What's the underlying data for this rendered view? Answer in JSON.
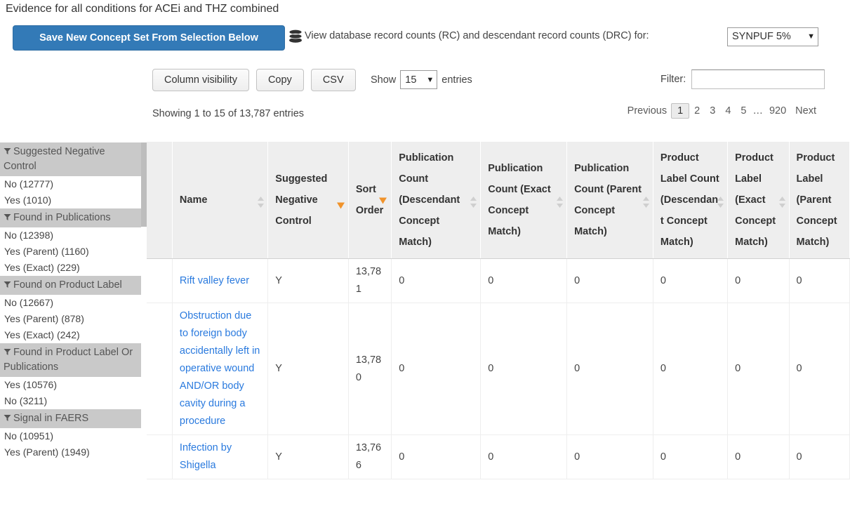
{
  "page_title": "Evidence for all conditions for ACEi and THZ combined",
  "toolbar": {
    "save_button_label": "Save New Concept Set From Selection Below",
    "db_icon": "database-icon",
    "record_counts_label": "View database record counts (RC) and descendant record counts (DRC) for:",
    "db_selected": "SYNPUF 5%",
    "caret": "▼"
  },
  "controls": {
    "column_visibility_label": "Column visibility",
    "copy_label": "Copy",
    "csv_label": "CSV",
    "show_label": "Show",
    "page_length_value": "15",
    "entries_label": "entries",
    "filter_label": "Filter:",
    "filter_value": "",
    "filter_placeholder": "",
    "info_text": "Showing 1 to 15 of 13,787 entries"
  },
  "pagination": {
    "previous": "Previous",
    "pages": [
      "1",
      "2",
      "3",
      "4",
      "5"
    ],
    "ellipsis": "…",
    "last_page": "920",
    "next": "Next",
    "current": "1"
  },
  "facets": [
    {
      "title": "Suggested Negative Control",
      "icon": "funnel-icon",
      "items": [
        "No (12777)",
        "Yes (1010)"
      ]
    },
    {
      "title": "Found in Publications",
      "icon": "funnel-icon",
      "items": [
        "No (12398)",
        "Yes (Parent) (1160)",
        "Yes (Exact) (229)"
      ]
    },
    {
      "title": "Found on Product Label",
      "icon": "funnel-icon",
      "items": [
        "No (12667)",
        "Yes (Parent) (878)",
        "Yes (Exact) (242)"
      ]
    },
    {
      "title": "Found in Product Label Or Publications",
      "icon": "funnel-icon",
      "items": [
        "Yes (10576)",
        "No (3211)"
      ]
    },
    {
      "title": "Signal in FAERS",
      "icon": "funnel-icon",
      "items": [
        "No (10951)",
        "Yes (Parent) (1949)"
      ]
    }
  ],
  "table": {
    "columns": [
      {
        "label": "",
        "sort": "none",
        "key": "check"
      },
      {
        "label": "Name",
        "sort": "both",
        "key": "name"
      },
      {
        "label": "Suggested Negative Control",
        "sort": "desc",
        "key": "snc"
      },
      {
        "label": "Sort Order",
        "sort": "desc",
        "key": "sortorder"
      },
      {
        "label": "Publication Count (Descendant Concept Match)",
        "sort": "both",
        "key": "pub_desc"
      },
      {
        "label": "Publication Count (Exact Concept Match)",
        "sort": "both",
        "key": "pub_exact"
      },
      {
        "label": "Publication Count (Parent Concept Match)",
        "sort": "both",
        "key": "pub_parent"
      },
      {
        "label": "Product Label Count (Descendant Concept Match)",
        "sort": "both",
        "key": "pl_desc"
      },
      {
        "label": "Product Label (Exact Concept Match)",
        "sort": "both",
        "key": "pl_exact"
      },
      {
        "label": "Product Label (Parent Concept Match)",
        "sort": "both",
        "key": "pl_parent"
      }
    ],
    "rows": [
      {
        "name": "Rift valley fever",
        "snc": "Y",
        "sortorder": "13,781",
        "pub_desc": "0",
        "pub_exact": "0",
        "pub_parent": "0",
        "pl_desc": "0",
        "pl_exact": "0",
        "pl_parent": "0"
      },
      {
        "name": "Obstruction due to foreign body accidentally left in operative wound AND/OR body cavity during a procedure",
        "snc": "Y",
        "sortorder": "13,780",
        "pub_desc": "0",
        "pub_exact": "0",
        "pub_parent": "0",
        "pl_desc": "0",
        "pl_exact": "0",
        "pl_parent": "0"
      },
      {
        "name": "Infection by Shigella",
        "snc": "Y",
        "sortorder": "13,766",
        "pub_desc": "0",
        "pub_exact": "0",
        "pub_parent": "0",
        "pl_desc": "0",
        "pl_exact": "0",
        "pl_parent": "0"
      }
    ]
  },
  "colors": {
    "primary_button": "#337ab7",
    "link": "#2a7ade",
    "sort_active": "#f0932b",
    "facet_header_bg": "#c9c9c9",
    "table_header_bg": "#eeeeee"
  }
}
